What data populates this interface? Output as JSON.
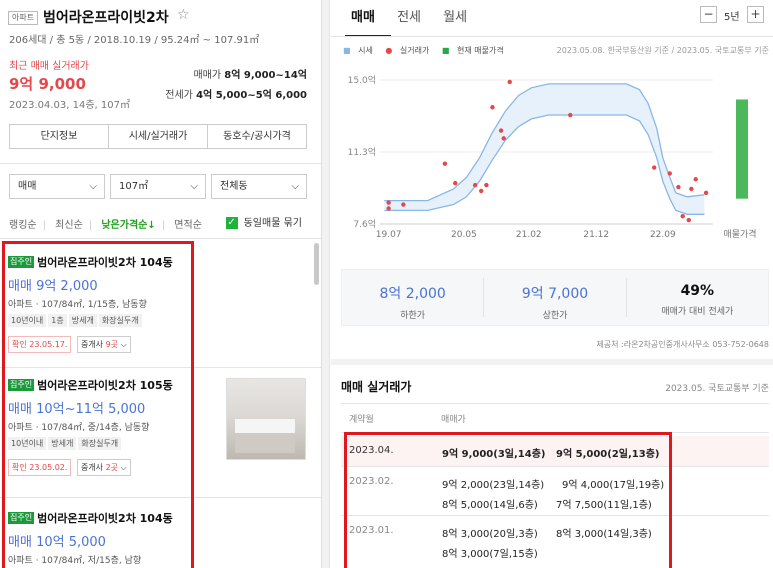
{
  "header": {
    "badge": "아파트",
    "name": "범어라온프라이빗2차",
    "star": "☆",
    "info": "206세대 / 총 5동 / 2018.10.19 / 95.24㎡ ~ 107.91㎡",
    "recent_label": "최근 매매 실거래가",
    "recent_price": "9억 9,000",
    "recent_date": "2023.04.03, 14층, 107㎡",
    "sale_label": "매매가",
    "sale_value": "8억 9,000~14억",
    "jeonse_label": "전세가",
    "jeonse_value": "4억 5,000~5억 6,000"
  },
  "buttons": [
    "단지정보",
    "시세/실거래가",
    "동호수/공시가격"
  ],
  "filters": {
    "type": "매매",
    "area": "107㎡",
    "dong": "전체동"
  },
  "sort": {
    "items": [
      "랭킹순",
      "최신순",
      "낮은가격순↓",
      "면적순"
    ],
    "same_listing": "동일매물 묶기"
  },
  "listings": [
    {
      "badge": "집주인",
      "title": "범어라온프라이빗2차 104동",
      "price_type": "매매",
      "price": "9억 2,000",
      "desc": "아파트 · 107/84㎡, 1/15층, 남동향",
      "tags": [
        "10년이내",
        "1층",
        "방세개",
        "화장실두개"
      ],
      "confirm": "확인 23.05.17.",
      "broker": "중개사",
      "broker_count": "9곳"
    },
    {
      "badge": "집주인",
      "title": "범어라온프라이빗2차 105동",
      "price_type": "매매",
      "price": "10억~11억 5,000",
      "desc": "아파트 · 107/84㎡, 중/14층, 남동향",
      "tags": [
        "10년이내",
        "방세개",
        "화장실두개"
      ],
      "confirm": "확인 23.05.02.",
      "broker": "중개사",
      "broker_count": "2곳"
    },
    {
      "badge": "집주인",
      "title": "범어라온프라이빗2차 104동",
      "price_type": "매매",
      "price": "10억 5,000",
      "desc": "아파트 · 107/84㎡, 저/15층, 남향"
    }
  ],
  "tabs": [
    "매매",
    "전세",
    "월세"
  ],
  "years": "5년",
  "legend": {
    "quote": "시세",
    "actual": "실거래가",
    "current": "현재 매물가격",
    "source": "2023.05.08. 한국부동산원 기준 / 2023.05. 국토교통부 기준"
  },
  "chart_data": {
    "type": "line",
    "y_ticks": [
      "15.0억",
      "11.3억",
      "7.6억"
    ],
    "x_ticks": [
      "19.07",
      "20.05",
      "21.02",
      "21.12",
      "22.09",
      "매물가격"
    ],
    "ylim": [
      7.6,
      15.0
    ],
    "upper_band": [
      [
        2019.5,
        8.8
      ],
      [
        2020.0,
        8.8
      ],
      [
        2020.3,
        9.4
      ],
      [
        2020.45,
        10.0
      ],
      [
        2020.6,
        11.0
      ],
      [
        2020.75,
        12.3
      ],
      [
        2020.9,
        13.4
      ],
      [
        2021.05,
        14.2
      ],
      [
        2021.2,
        14.6
      ],
      [
        2021.4,
        14.8
      ],
      [
        2022.3,
        14.8
      ],
      [
        2022.45,
        14.5
      ],
      [
        2022.55,
        13.8
      ],
      [
        2022.65,
        12.5
      ],
      [
        2022.72,
        11.0
      ],
      [
        2022.8,
        10.0
      ],
      [
        2022.87,
        9.2
      ],
      [
        2023.0,
        9.0
      ],
      [
        2023.2,
        9.1
      ]
    ],
    "lower_band": [
      [
        2019.5,
        8.3
      ],
      [
        2020.0,
        8.3
      ],
      [
        2020.3,
        8.6
      ],
      [
        2020.45,
        9.0
      ],
      [
        2020.6,
        9.8
      ],
      [
        2020.75,
        10.9
      ],
      [
        2020.9,
        11.9
      ],
      [
        2021.05,
        12.6
      ],
      [
        2021.2,
        13.0
      ],
      [
        2021.4,
        13.2
      ],
      [
        2022.3,
        13.2
      ],
      [
        2022.45,
        12.9
      ],
      [
        2022.55,
        12.2
      ],
      [
        2022.65,
        11.0
      ],
      [
        2022.72,
        9.8
      ],
      [
        2022.8,
        8.9
      ],
      [
        2022.87,
        8.3
      ],
      [
        2023.0,
        8.1
      ],
      [
        2023.2,
        8.1
      ]
    ],
    "actual_points": [
      [
        2019.55,
        8.4
      ],
      [
        2019.55,
        8.7
      ],
      [
        2019.72,
        8.6
      ],
      [
        2020.2,
        10.7
      ],
      [
        2020.32,
        9.7
      ],
      [
        2020.55,
        9.6
      ],
      [
        2020.62,
        9.3
      ],
      [
        2020.68,
        9.6
      ],
      [
        2020.75,
        13.6
      ],
      [
        2020.85,
        12.4
      ],
      [
        2020.88,
        12.0
      ],
      [
        2020.95,
        14.9
      ],
      [
        2021.65,
        13.2
      ],
      [
        2022.62,
        10.5
      ],
      [
        2022.8,
        10.2
      ],
      [
        2022.9,
        9.5
      ],
      [
        2022.95,
        8.0
      ],
      [
        2023.02,
        7.8
      ],
      [
        2023.05,
        9.4
      ],
      [
        2023.1,
        9.9
      ],
      [
        2023.22,
        9.2
      ]
    ],
    "listing_range": [
      8.9,
      14.0
    ]
  },
  "stats": [
    {
      "value": "8억 2,000",
      "label": "하한가"
    },
    {
      "value": "9억 7,000",
      "label": "상한가"
    },
    {
      "value": "49%",
      "label": "매매가 대비 전세가"
    }
  ],
  "provider": "제공처 :라온2차공인중개사사무소 053-752-0648",
  "deals": {
    "title": "매매 실거래가",
    "source": "2023.05. 국토교통부 기준",
    "col_month": "계약월",
    "col_price": "매매가",
    "rows": [
      {
        "month": "2023.04.",
        "txs": [
          "9억 9,000(3일,14층)",
          "9억 5,000(2일,13층)"
        ]
      },
      {
        "month": "2023.02.",
        "txs": [
          "9억 2,000(23일,14층)",
          "9억 4,000(17일,19층)",
          "8억 5,000(14일,6층)",
          "7억 7,500(11일,1층)"
        ]
      },
      {
        "month": "2023.01.",
        "txs": [
          "8억 3,000(20일,3층)",
          "8억 3,000(14일,3층)",
          "8억 3,000(7일,15층)"
        ]
      }
    ]
  },
  "colors": {
    "accent_red": "#e4484b",
    "accent_blue": "#4a73d6",
    "accent_green": "#27a745",
    "highlight_frame": "#e1171e"
  }
}
